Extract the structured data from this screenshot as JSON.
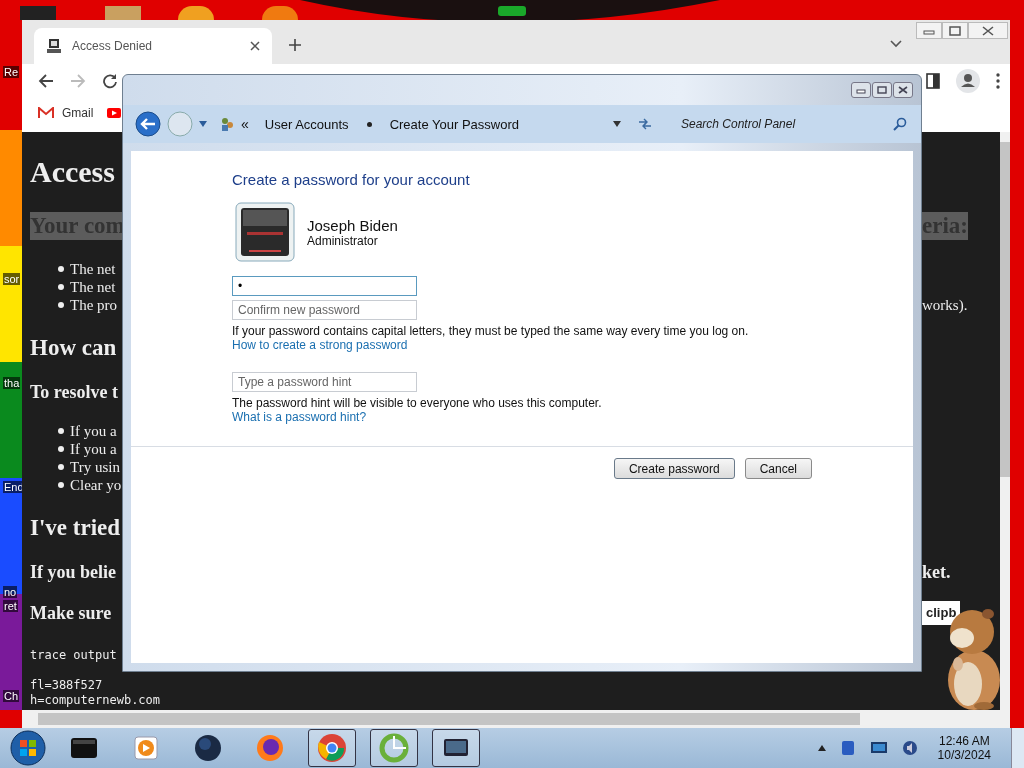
{
  "desktop": {
    "icon_labels": [
      "Re",
      "sor",
      "tha",
      "End",
      "no",
      "ret",
      "Ch"
    ]
  },
  "browser": {
    "tabs": [
      {
        "title": "Access Denied",
        "selected": true
      }
    ],
    "bookmark": {
      "label": "Gmail"
    },
    "page_lines": [
      {
        "kind": "h1",
        "left": "Access"
      },
      {
        "kind": "highlight",
        "left": "Your com",
        "right": "eria:"
      },
      {
        "kind": "bullet",
        "left": "The net"
      },
      {
        "kind": "bullet",
        "left": "The net"
      },
      {
        "kind": "bullet",
        "left": "The pro",
        "right": "works)."
      },
      {
        "kind": "h2",
        "left": "How can"
      },
      {
        "kind": "h3",
        "left": "To resolve t"
      },
      {
        "kind": "bullet",
        "left": "If you a"
      },
      {
        "kind": "bullet",
        "left": "If you a"
      },
      {
        "kind": "bullet",
        "left": "Try usin"
      },
      {
        "kind": "bullet",
        "left": "Clear yo"
      },
      {
        "kind": "h2",
        "left": "I've tried"
      },
      {
        "kind": "h3",
        "left": "If you belie",
        "right": "ket."
      },
      {
        "kind": "h3",
        "left": "Make sure",
        "right_button": "clipb"
      },
      {
        "kind": "mono",
        "left": "trace output"
      },
      {
        "kind": "mono-gap",
        "left": "fl=388f527"
      },
      {
        "kind": "mono",
        "left": "h=computernewb.com"
      }
    ]
  },
  "control_panel": {
    "overflow_glyph": "«",
    "breadcrumb": [
      "User Accounts",
      "Create Your Password"
    ],
    "search": {
      "placeholder": "Search Control Panel"
    },
    "heading": "Create a password for your account",
    "user": {
      "name": "Joseph Biden",
      "role": "Administrator"
    },
    "password_fields": [
      {
        "value": "•",
        "focused": true
      },
      {
        "placeholder": "Confirm new password",
        "focused": false
      }
    ],
    "capital_note": "If your password contains capital letters, they must be typed the same way every time you log on.",
    "strong_link": "How to create a strong password",
    "hint_field": {
      "placeholder": "Type a password hint",
      "focused": false
    },
    "hint_note": "The password hint will be visible to everyone who uses this computer.",
    "hint_link": "What is a password hint?",
    "buttons": [
      "Create password",
      "Cancel"
    ]
  },
  "taskbar": {
    "apps": [
      {
        "kind": "box",
        "active": false
      },
      {
        "kind": "player",
        "active": false
      },
      {
        "kind": "globe",
        "active": false
      },
      {
        "kind": "firefox",
        "active": false
      },
      {
        "kind": "chrome",
        "active": true
      },
      {
        "kind": "ring",
        "active": true
      },
      {
        "kind": "monitor",
        "active": true
      }
    ],
    "clock": {
      "time": "12:46 AM",
      "date": "10/3/2024"
    }
  }
}
